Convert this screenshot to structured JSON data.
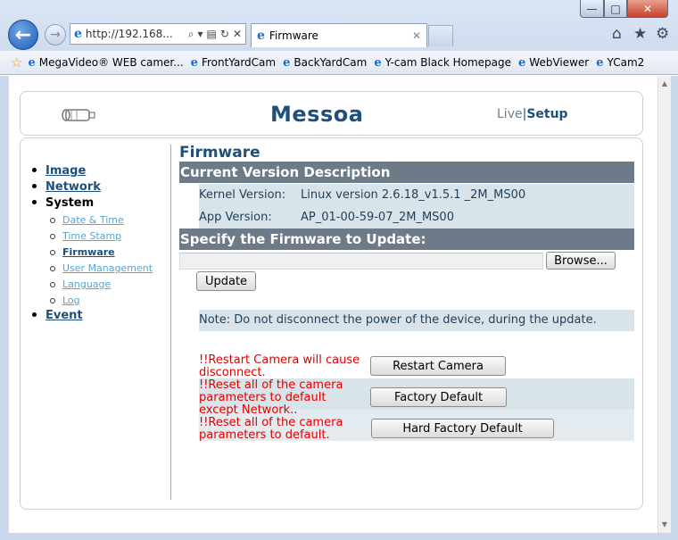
{
  "browser": {
    "address": "http://192.168...",
    "tab_title": "Firmware",
    "window_controls": {
      "minimize": "—",
      "maximize": "□",
      "close": "✕"
    },
    "favorites": [
      "MegaVideo® WEB camer...",
      "FrontYardCam",
      "BackYardCam",
      "Y-cam Black Homepage",
      "WebViewer",
      "YCam2"
    ],
    "icons": [
      "back-arrow-icon",
      "forward-arrow-icon",
      "ie-logo-icon",
      "search-icon",
      "refresh-icon",
      "stop-icon",
      "home-icon",
      "favorites-star-icon",
      "gear-icon"
    ]
  },
  "header": {
    "brand": "Messoa",
    "live_label": "Live",
    "separator": "|",
    "setup_label": "Setup"
  },
  "sidebar": {
    "items": [
      {
        "label": "Image"
      },
      {
        "label": "Network"
      },
      {
        "label": "System"
      },
      {
        "label": "Event"
      }
    ],
    "system_children": [
      {
        "label": "Date & Time"
      },
      {
        "label": "Time Stamp"
      },
      {
        "label": "Firmware"
      },
      {
        "label": "User Management"
      },
      {
        "label": "Language"
      },
      {
        "label": "Log"
      }
    ]
  },
  "main": {
    "title": "Firmware",
    "version_section": "Current Version Description",
    "kernel_label": "Kernel Version:",
    "kernel_value": "Linux version 2.6.18_v1.5.1 _2M_MS00",
    "app_label": "App Version:",
    "app_value": "AP_01-00-59-07_2M_MS00",
    "update_section": "Specify the Firmware to Update:",
    "browse_label": "Browse...",
    "update_label": "Update",
    "note": "Note: Do not disconnect the power of the device, during the update.",
    "restart_warning": "!!Restart Camera will cause disconnect.",
    "restart_label": "Restart Camera",
    "factory_warning": "!!Reset all of the camera parameters to default except Network..",
    "factory_label": "Factory Default",
    "hard_warning": "!!Reset all of the camera parameters to default.",
    "hard_label": "Hard Factory Default"
  },
  "colors": {
    "brand_blue": "#1f4f7a",
    "section_bar": "#6d7a87",
    "info_bg": "#d9e3ea",
    "warning_red": "#e00000",
    "sublink": "#57a6cf"
  }
}
